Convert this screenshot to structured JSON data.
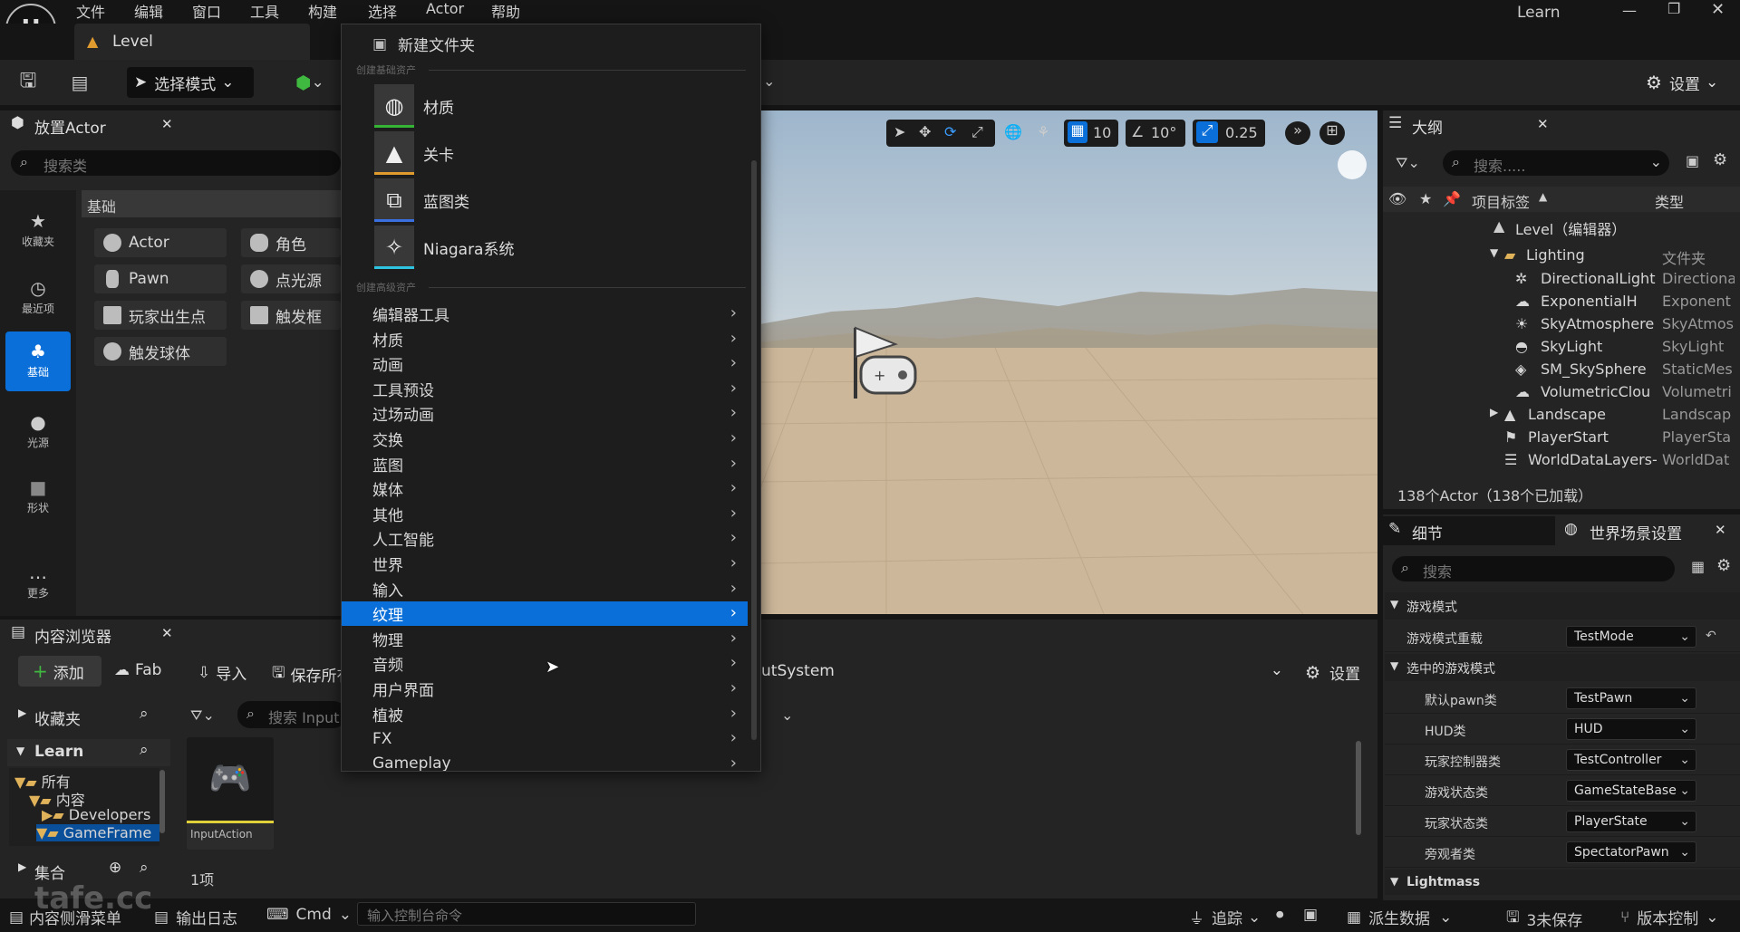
{
  "menubar": [
    "文件",
    "编辑",
    "窗口",
    "工具",
    "构建",
    "选择",
    "Actor",
    "帮助"
  ],
  "project_name": "Learn",
  "level_tab": "Level",
  "toolbar": {
    "select_mode": "选择模式",
    "settings": "设置"
  },
  "place_actor": {
    "title": "放置Actor",
    "search_placeholder": "搜索类",
    "section": "基础",
    "categories": [
      "收藏夹",
      "最近项",
      "基础",
      "光源",
      "形状",
      "更多"
    ],
    "items": [
      "Actor",
      "角色",
      "Pawn",
      "点光源",
      "玩家出生点",
      "触发框",
      "触发球体"
    ]
  },
  "viewport": {
    "grid": "10",
    "angle": "10°",
    "scale": "0.25"
  },
  "dropdown": {
    "new_folder": "新建文件夹",
    "section_basic": "创建基础资产",
    "basic_assets": [
      {
        "label": "材质",
        "color": "#35b335"
      },
      {
        "label": "关卡",
        "color": "#e09b2e"
      },
      {
        "label": "蓝图类",
        "color": "#3a6fe0"
      },
      {
        "label": "Niagara系统",
        "color": "#2ec3e0"
      }
    ],
    "section_advanced": "创建高级资产",
    "advanced": [
      "编辑器工具",
      "材质",
      "动画",
      "工具预设",
      "过场动画",
      "交换",
      "蓝图",
      "媒体",
      "其他",
      "人工智能",
      "世界",
      "输入",
      "纹理",
      "物理",
      "音频",
      "用户界面",
      "植被",
      "FX",
      "Gameplay"
    ],
    "highlighted": "纹理"
  },
  "outliner": {
    "title": "大纲",
    "search_placeholder": "搜索.....",
    "col_label": "项目标签",
    "col_type": "类型",
    "rows": [
      {
        "name": "Level（编辑器）",
        "type": ""
      },
      {
        "name": "Lighting",
        "type": "文件夹"
      },
      {
        "name": "DirectionalLight",
        "type": "Directiona"
      },
      {
        "name": "ExponentialHeig",
        "type": "Exponent"
      },
      {
        "name": "SkyAtmosphere",
        "type": "SkyAtmos"
      },
      {
        "name": "SkyLight",
        "type": "SkyLight"
      },
      {
        "name": "SM_SkySphere",
        "type": "StaticMes"
      },
      {
        "name": "VolumetricClouc",
        "type": "Volumetri"
      },
      {
        "name": "Landscape",
        "type": "Landscap"
      },
      {
        "name": "PlayerStart",
        "type": "PlayerSta"
      },
      {
        "name": "WorldDataLayers-",
        "type": "WorldDat"
      }
    ],
    "count": "138个Actor（138个已加载）"
  },
  "details": {
    "tab_details": "细节",
    "tab_world": "世界场景设置",
    "search_placeholder": "搜索",
    "group_game_mode": "游戏模式",
    "override_label": "游戏模式重载",
    "override_value": "TestMode",
    "group_selected": "选中的游戏模式",
    "props": [
      {
        "label": "默认pawn类",
        "value": "TestPawn"
      },
      {
        "label": "HUD类",
        "value": "HUD"
      },
      {
        "label": "玩家控制器类",
        "value": "TestController"
      },
      {
        "label": "游戏状态类",
        "value": "GameStateBase"
      },
      {
        "label": "玩家状态类",
        "value": "PlayerState"
      },
      {
        "label": "旁观者类",
        "value": "SpectatorPawn"
      }
    ],
    "group_lightmass": "Lightmass"
  },
  "content_browser": {
    "title": "内容浏览器",
    "add": "添加",
    "fab": "Fab",
    "import": "导入",
    "save_all": "保存所有",
    "path": "utSystem",
    "settings": "设置",
    "favorites": "收藏夹",
    "project": "Learn",
    "search_placeholder": "搜索 Input",
    "tree": [
      "所有",
      "内容",
      "Developers",
      "GameFrame"
    ],
    "collections": "集合",
    "asset_name": "InputAction",
    "item_count": "1项"
  },
  "statusbar": {
    "drawer": "内容侧滑菜单",
    "output_log": "输出日志",
    "cmd": "Cmd",
    "console_placeholder": "输入控制台命令",
    "trace": "追踪",
    "derived_data": "派生数据",
    "unsaved": "3未保存",
    "source_control": "版本控制"
  },
  "watermark": "tafe.cc"
}
